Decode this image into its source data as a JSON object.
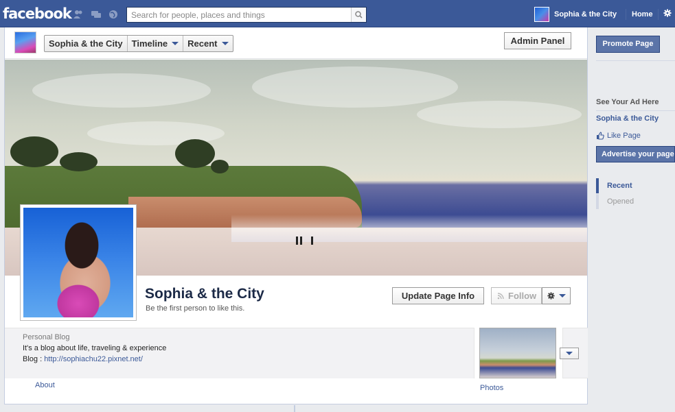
{
  "topbar": {
    "logo": "facebook",
    "search_placeholder": "Search for people, places and things",
    "user_name": "Sophia & the City",
    "home_label": "Home"
  },
  "page_head": {
    "breadcrumbs": [
      {
        "label": "Sophia & the City",
        "has_caret": false
      },
      {
        "label": "Timeline",
        "has_caret": true
      },
      {
        "label": "Recent",
        "has_caret": true
      }
    ],
    "admin_button": "Admin Panel"
  },
  "profile": {
    "name": "Sophia & the City",
    "subtitle": "Be the first person to like this.",
    "update_button": "Update Page Info",
    "follow_button": "Follow"
  },
  "info": {
    "category": "Personal Blog",
    "description": "It's a blog about life, traveling & experience",
    "blog_prefix": "Blog : ",
    "blog_url": "http://sophiachu22.pixnet.net/",
    "about_link": "About",
    "photos_link": "Photos"
  },
  "sidebar": {
    "promote_button": "Promote Page",
    "ad_heading": "See Your Ad Here",
    "ad_title": "Sophia & the City",
    "like_page": "Like Page",
    "advertise": "Advertise your page",
    "filters": [
      {
        "label": "Recent",
        "active": true
      },
      {
        "label": "Opened",
        "active": false
      }
    ]
  },
  "colors": {
    "brand_blue": "#3b5998",
    "button_blue": "#5b74a8"
  }
}
